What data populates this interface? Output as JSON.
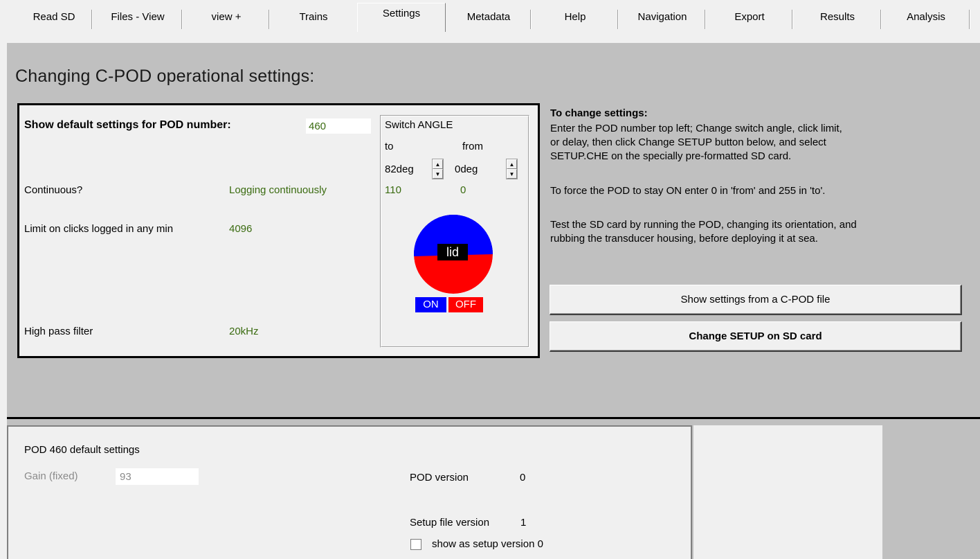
{
  "tabs": [
    {
      "label": "Read SD"
    },
    {
      "label": "Files - View"
    },
    {
      "label": "view +"
    },
    {
      "label": "Trains"
    },
    {
      "label": "Settings",
      "active": true
    },
    {
      "label": "Metadata"
    },
    {
      "label": "Help"
    },
    {
      "label": "Navigation"
    },
    {
      "label": "Export"
    },
    {
      "label": "Results"
    },
    {
      "label": "Analysis"
    }
  ],
  "heading": "Changing C-POD operational settings:",
  "defaults": {
    "pod_label": "Show default settings for POD number:",
    "pod_number": "460",
    "continuous_label": "Continuous?",
    "continuous_value": "Logging continuously",
    "limit_label": "Limit on clicks logged in any min",
    "limit_value": "4096",
    "filter_label": "High pass filter",
    "filter_value": "20kHz"
  },
  "switch_angle": {
    "title": "Switch ANGLE",
    "to_label": "to",
    "from_label": "from",
    "to_deg": "82deg",
    "from_deg": "0deg",
    "to_value": "110",
    "from_value": "0",
    "lid_label": "lid",
    "on_label": "ON",
    "off_label": "OFF",
    "colors": {
      "on": "#0000ff",
      "off": "#ff0000"
    }
  },
  "instructions": {
    "title": "To change settings:",
    "line1": "Enter the POD number top left;        Change switch angle, click limit,",
    "line2": "or delay, then click Change SETUP button below, and select",
    "line3": "SETUP.CHE on the specially pre-formatted SD card.",
    "line4": "To force the POD to stay ON enter 0 in 'from' and 255 in 'to'.",
    "line5": "Test the SD card by running the POD, changing its orientation, and",
    "line6": "rubbing the transducer housing, before deploying it at sea."
  },
  "buttons": {
    "show_settings": "Show settings from a  C-POD file",
    "change_setup": "Change SETUP on SD card"
  },
  "bottom": {
    "title": "POD 460 default settings",
    "gain_label": "Gain (fixed)",
    "gain_value": "93",
    "pod_version_label": "POD version",
    "pod_version_value": "0",
    "setup_version_label": "Setup file version",
    "setup_version_value": "1",
    "checkbox_label": "show as setup version 0"
  }
}
